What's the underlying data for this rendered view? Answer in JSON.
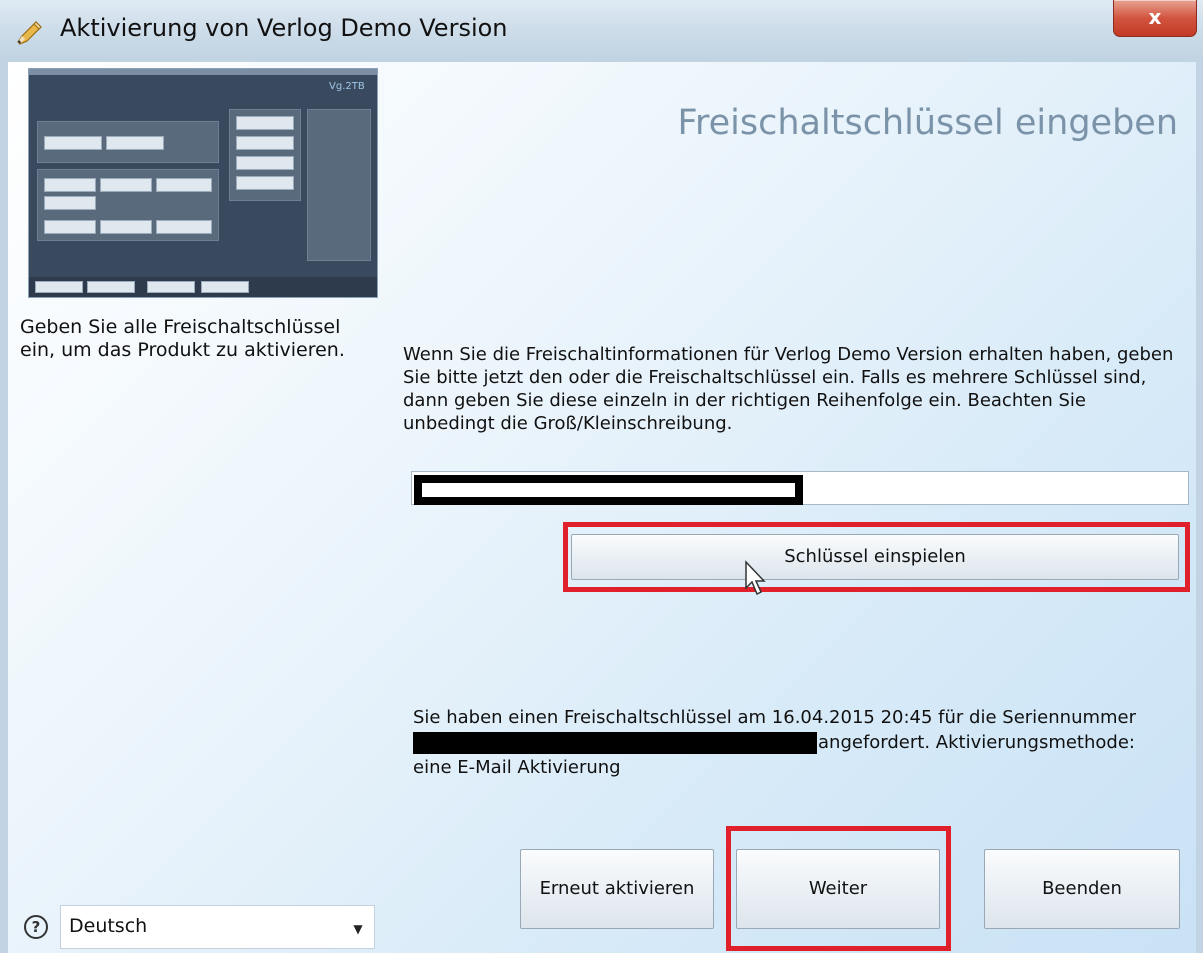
{
  "window": {
    "title": "Aktivierung von Verlog Demo Version",
    "close_label": "x"
  },
  "sidebar": {
    "preview_logo": "Vg.2TB",
    "description": "Geben Sie alle Freischaltschlüssel ein, um das Produkt zu aktivieren."
  },
  "main": {
    "heading": "Freischaltschlüssel eingeben",
    "instructions": "Wenn Sie die Freischaltinformationen für Verlog Demo Version erhalten haben, geben Sie bitte jetzt den oder die Freischaltschlüssel ein. Falls es mehrere Schlüssel sind, dann geben Sie diese einzeln in der richtigen Reihenfolge ein. Beachten Sie unbedingt die Groß/Kleinschreibung.",
    "key_input_value": "",
    "apply_key_button": "Schlüssel einspielen",
    "status_line1": "Sie haben einen Freischaltschlüssel am 16.04.2015 20:45 für die Seriennummer",
    "status_line2": "angefordert. Aktivierungsmethode:",
    "status_line3": "eine E-Mail Aktivierung"
  },
  "footer": {
    "language": "Deutsch",
    "help_icon": "?",
    "buttons": {
      "reactivate": "Erneut aktivieren",
      "next": "Weiter",
      "quit": "Beenden"
    }
  },
  "colors": {
    "highlight": "#e0212b",
    "heading": "#7b93a8"
  }
}
